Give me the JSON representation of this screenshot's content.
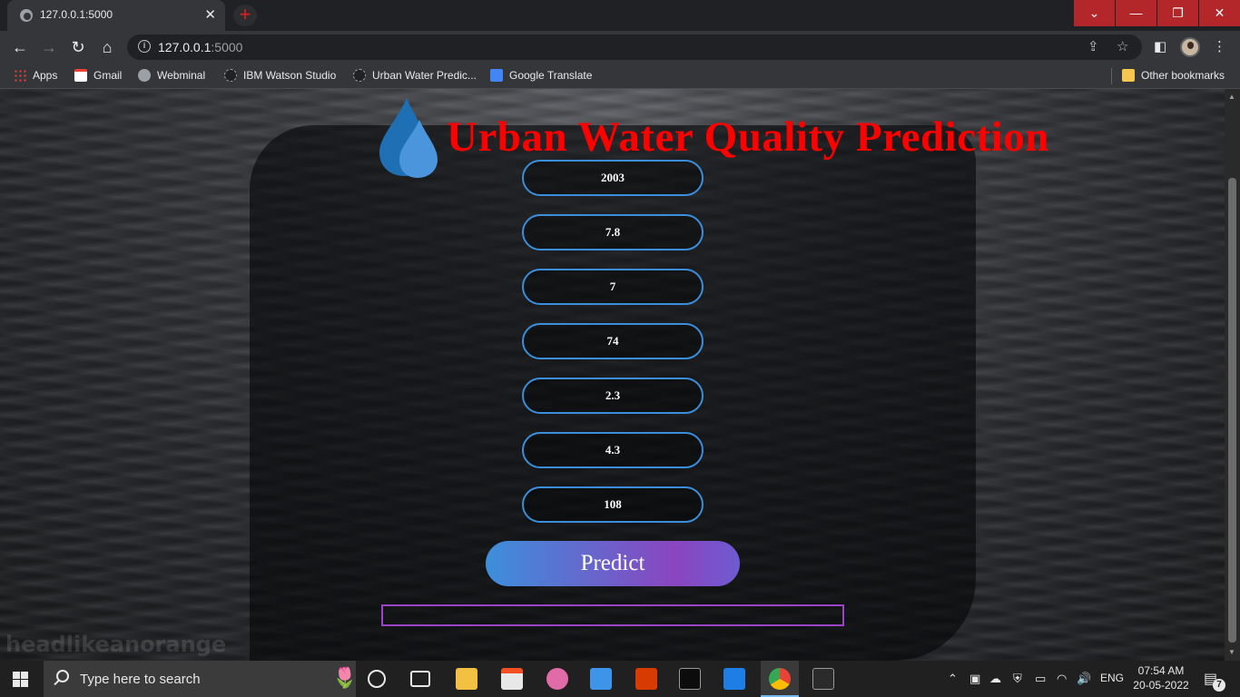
{
  "browser": {
    "tab_title": "127.0.0.1:5000",
    "tab_close": "✕",
    "new_tab": "+",
    "url_host": "127.0.0.1",
    "url_port": ":5000",
    "window_controls": {
      "collapse": "⌄",
      "minimize": "—",
      "restore": "❐",
      "close": "✕"
    }
  },
  "bookmarks": {
    "apps": "Apps",
    "gmail": "Gmail",
    "webminal": "Webminal",
    "ibm": "IBM Watson Studio",
    "urban": "Urban Water Predic...",
    "translate": "Google Translate",
    "other": "Other bookmarks"
  },
  "page": {
    "title": "Urban Water Quality Prediction",
    "watermark": "headlikeanorange",
    "inputs": [
      "2003",
      "7.8",
      "7",
      "74",
      "2.3",
      "4.3",
      "108"
    ],
    "predict_label": "Predict",
    "result_text": ""
  },
  "taskbar": {
    "search_placeholder": "Type here to search",
    "language": "ENG",
    "time": "07:54 AM",
    "date": "20-05-2022",
    "notification_count": "7"
  },
  "colors": {
    "title_red": "#ff0000",
    "field_border": "#3b8edc",
    "predict_gradient_start": "#3c8fdc",
    "predict_gradient_end": "#8a45c0",
    "result_border": "#9c44c8"
  }
}
